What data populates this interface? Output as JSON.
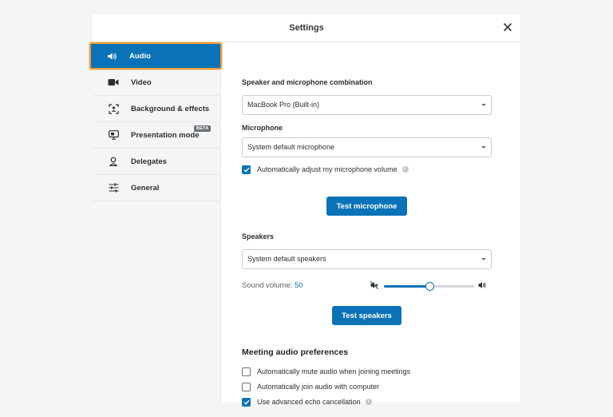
{
  "dialog": {
    "title": "Settings",
    "close_icon": "close-icon"
  },
  "sidebar": {
    "items": [
      {
        "label": "Audio",
        "icon": "speaker-icon",
        "active": true
      },
      {
        "label": "Video",
        "icon": "video-camera-icon"
      },
      {
        "label": "Background & effects",
        "icon": "background-effects-icon"
      },
      {
        "label": "Presentation mode",
        "icon": "monitor-icon",
        "badge": "BETA"
      },
      {
        "label": "Delegates",
        "icon": "person-icon"
      },
      {
        "label": "General",
        "icon": "sliders-icon"
      }
    ]
  },
  "audio": {
    "combo_label": "Speaker and microphone combination",
    "combo_value": "MacBook Pro (Built-in)",
    "mic_label": "Microphone",
    "mic_value": "System default microphone",
    "auto_adjust_label": "Automatically adjust my microphone volume",
    "auto_adjust_checked": true,
    "test_mic_label": "Test microphone",
    "speakers_label": "Speakers",
    "speakers_value": "System default speakers",
    "volume_label": "Sound volume: ",
    "volume_value": "50",
    "volume_level": 0.5,
    "test_speakers_label": "Test speakers",
    "prefs_heading": "Meeting audio preferences",
    "prefs": [
      {
        "label": "Automatically mute audio when joining meetings",
        "checked": false
      },
      {
        "label": "Automatically join audio with computer",
        "checked": false
      },
      {
        "label": "Use advanced echo cancellation",
        "checked": true,
        "info": true
      }
    ]
  },
  "colors": {
    "accent": "#0a73b7",
    "focus_ring": "#f59a33"
  }
}
